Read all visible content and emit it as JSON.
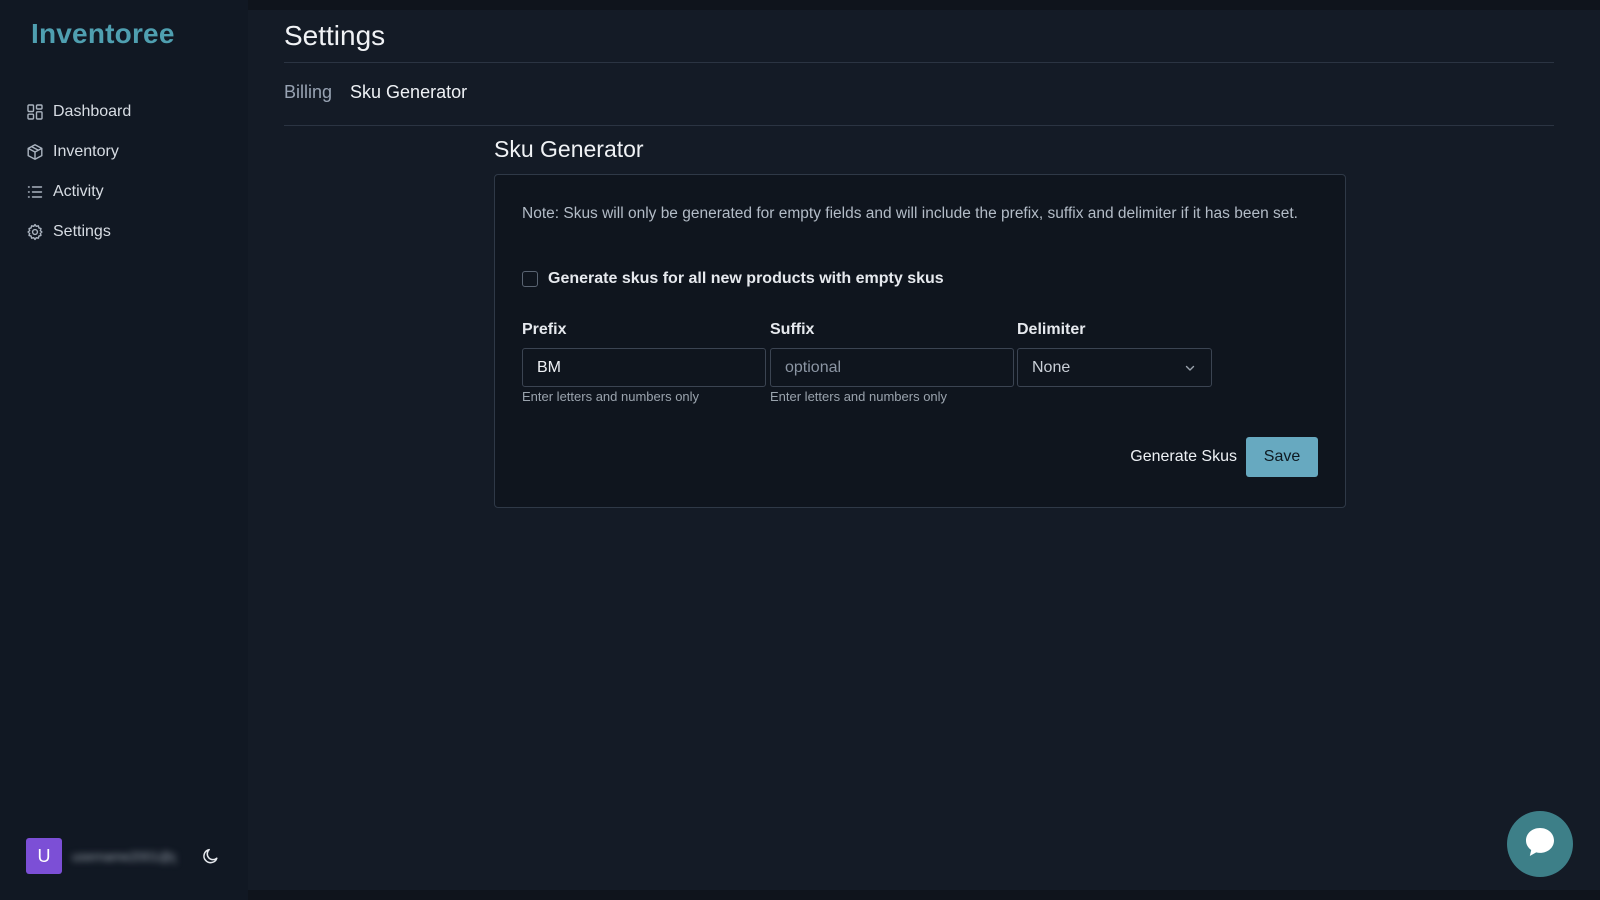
{
  "app": {
    "brand": "Inventoree",
    "accent_color": "#4f9fb0"
  },
  "sidebar": {
    "items": [
      {
        "label": "Dashboard",
        "icon": "dashboard-icon"
      },
      {
        "label": "Inventory",
        "icon": "box-icon"
      },
      {
        "label": "Activity",
        "icon": "list-icon"
      },
      {
        "label": "Settings",
        "icon": "gear-icon"
      }
    ],
    "user": {
      "avatar_letter": "U",
      "email": "username2001@g...",
      "avatar_color": "#7c4fd6"
    },
    "theme_toggle_icon": "moon-icon"
  },
  "header": {
    "title": "Settings"
  },
  "tabs": [
    {
      "label": "Billing",
      "active": false
    },
    {
      "label": "Sku Generator",
      "active": true
    }
  ],
  "sku_generator": {
    "title": "Sku Generator",
    "note": "Note: Skus will only be generated for empty fields and will include the prefix, suffix and delimiter if it has been set.",
    "auto_generate": {
      "label": "Generate skus for all new products with empty skus",
      "checked": false
    },
    "prefix": {
      "label": "Prefix",
      "value": "BM",
      "placeholder": "optional",
      "helper": "Enter letters and numbers only"
    },
    "suffix": {
      "label": "Suffix",
      "value": "",
      "placeholder": "optional",
      "helper": "Enter letters and numbers only"
    },
    "delimiter": {
      "label": "Delimiter",
      "selected": "None"
    },
    "actions": {
      "generate_label": "Generate Skus",
      "save_label": "Save",
      "save_color": "#67a9c0"
    }
  },
  "chat": {
    "icon": "chat-bubble-icon",
    "color": "#3d7f88"
  }
}
